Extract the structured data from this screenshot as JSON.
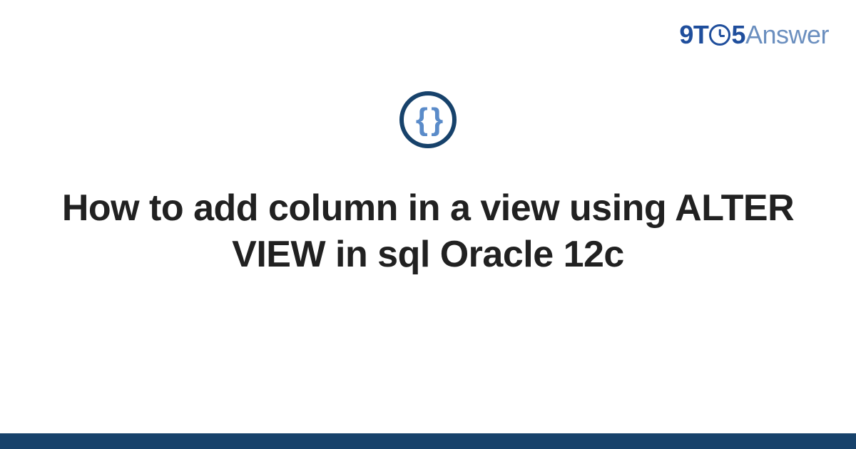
{
  "brand": {
    "part1": "9",
    "part2": "T",
    "part3": "5",
    "part4": "Answer"
  },
  "icon": {
    "name": "code-braces-icon",
    "glyph": "{ }"
  },
  "title": "How to add column in a view using ALTER VIEW in sql Oracle 12c",
  "colors": {
    "brandPrimary": "#1f4e9c",
    "brandSecondary": "#6b8fbf",
    "iconRing": "#17426b",
    "iconBraces": "#5a8bc9",
    "titleText": "#212121",
    "bottomBar": "#17426b"
  }
}
